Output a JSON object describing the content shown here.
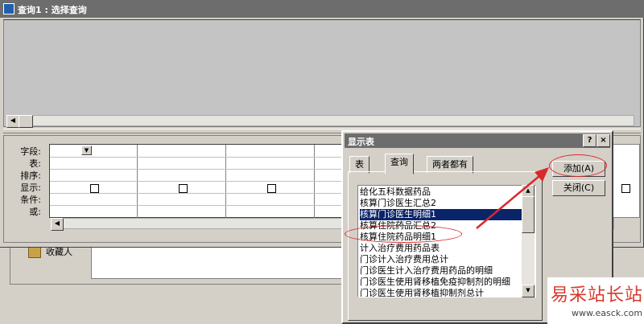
{
  "background_form": {
    "label": "收藏人"
  },
  "query_window": {
    "title": "查询1 : 选择查询",
    "grid_row_labels": [
      "字段:",
      "表:",
      "排序:",
      "显示:",
      "条件:",
      "或:"
    ]
  },
  "dialog": {
    "title": "显示表",
    "help_button": "?",
    "close_button": "×",
    "tabs": [
      "表",
      "查询",
      "两者都有"
    ],
    "active_tab": "查询",
    "list_items": [
      "给化五科数据药品",
      "核算门诊医生汇总2",
      "核算门诊医生明细1",
      "核算住院药品汇总2",
      "核算住院药品明细1",
      "计入治疗费用药品表",
      "门诊计入治疗费用总计",
      "门诊医生计入治疗费用药品的明细",
      "门诊医生使用肾移植免疫抑制剂的明细",
      "门诊医生使用肾移植抑制剂总计"
    ],
    "selected_item": "核算门诊医生明细1",
    "add_button": "添加(A)",
    "close_btn_label": "关闭(C)"
  },
  "annotation": {
    "arrow_color": "#d9282b"
  },
  "watermark": {
    "main": "易采站长站",
    "url": "www.easck.com"
  }
}
